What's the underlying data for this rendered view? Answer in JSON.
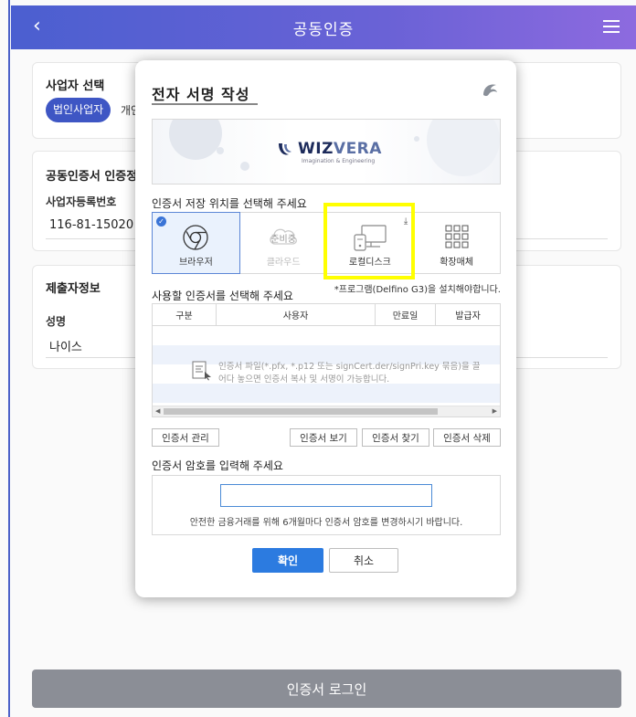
{
  "header": {
    "back_icon": "chevron-left-icon",
    "title": "공동인증",
    "menu_icon": "hamburger-menu-icon"
  },
  "business_card": {
    "title": "사업자 선택",
    "selected_option": "법인사업자",
    "next_option": "개인"
  },
  "cert_card": {
    "title": "공동인증서 인증정",
    "reg_label": "사업자등록번호",
    "reg_value": "116-81-15020"
  },
  "submitter_card": {
    "title": "제출자정보",
    "name_label": "성명",
    "name_value": "나이스"
  },
  "bottom_button": "인증서 로그인",
  "modal": {
    "title": "전자 서명 작성",
    "banner": {
      "brand_a": "WIZ",
      "brand_b": "VERA",
      "tagline": "Imagination & Engineering"
    },
    "storage_label": "인증서 저장 위치를 선택해 주세요",
    "storage_options": [
      {
        "label": "브라우저",
        "icon": "browser-icon",
        "state": "selected"
      },
      {
        "label": "클라우드",
        "icon": "cloud-icon",
        "badge": "준비중",
        "state": "disabled"
      },
      {
        "label": "로컬디스크",
        "icon": "local-disk-icon",
        "state": "normal"
      },
      {
        "label": "확장매체",
        "icon": "grid-icon",
        "state": "normal"
      }
    ],
    "cert_label": "사용할 인증서를 선택해 주세요",
    "install_note": "*프로그램(Delfino G3)을 설치해야합니다.",
    "table_headers": [
      "구분",
      "사용자",
      "만료일",
      "발급자"
    ],
    "empty_message": "인증서 파일(*.pfx, *.p12 또는 signCert.der/signPri.key 묶음)을 끌어다 놓으면 인증서 복사 및 서명이 가능합니다.",
    "buttons": {
      "manage": "인증서 관리",
      "view": "인증서 보기",
      "find": "인증서 찾기",
      "delete": "인증서 삭제"
    },
    "password_label": "인증서 암호를 입력해 주세요",
    "password_value": "",
    "password_note": "안전한 금융거래를 위해 6개월마다 인증서 암호를 변경하시기 바랍니다.",
    "confirm": "확인",
    "cancel": "취소"
  },
  "colors": {
    "header_start": "#4b5fd0",
    "header_end": "#8d6adf",
    "accent": "#3e56c4",
    "confirm_button": "#2c7be0",
    "highlight": "#ffff00",
    "login_button": "#8b8e96"
  }
}
